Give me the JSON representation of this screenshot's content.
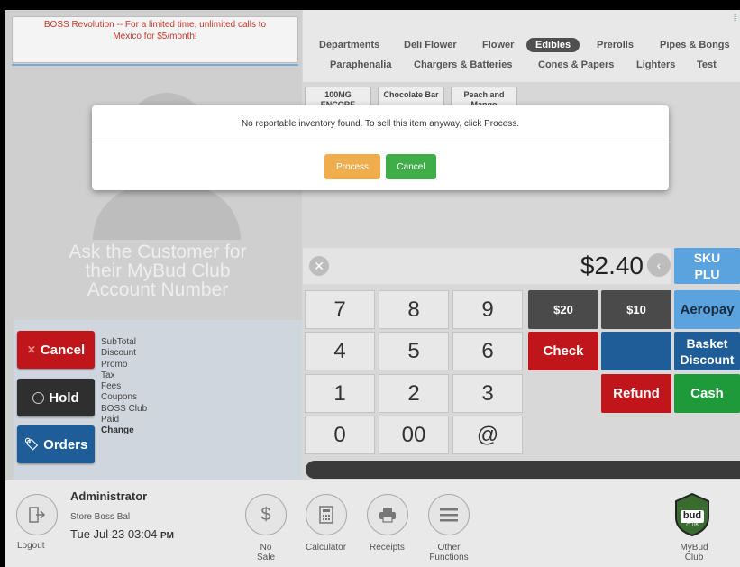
{
  "promo": {
    "line1": "BOSS Revolution -- For a limited time, unlimited calls to",
    "line2": "Mexico for $5/month!"
  },
  "customer": {
    "line1": "Ask the Customer for",
    "line2": "their MyBud Club",
    "line3": "Account Number"
  },
  "left_buttons": {
    "cancel": "Cancel",
    "hold": "Hold",
    "orders": "Orders"
  },
  "totals": [
    "SubTotal",
    "Discount",
    "Promo",
    "Tax",
    "Fees",
    "Coupons",
    "BOSS Club",
    "Paid",
    "Change"
  ],
  "categories_row1": [
    "Departments",
    "Deli Flower",
    "Flower",
    "Edibles",
    "Prerolls",
    "Pipes & Bongs"
  ],
  "categories_row2": [
    "Paraphenalia",
    "Chargers & Batteries",
    "Cones & Papers",
    "Lighters",
    "Test"
  ],
  "active_category": "Edibles",
  "products": [
    {
      "line1": "100MG",
      "line2": "ENCORE"
    },
    {
      "line1": "Chocolate Bar",
      "line2": ""
    },
    {
      "line1": "Peach and",
      "line2": "Mango"
    }
  ],
  "amount": "$2.40",
  "keypad": [
    "7",
    "8",
    "9",
    "4",
    "5",
    "6",
    "1",
    "2",
    "3",
    "0",
    "00",
    "@"
  ],
  "function_keys": {
    "sku_line1": "SKU",
    "sku_line2": "PLU",
    "k20": "$20",
    "k10": "$10",
    "aeropay": "Aeropay",
    "check": "Check",
    "basket_line1": "Basket",
    "basket_line2": "Discount",
    "refund": "Refund",
    "cash": "Cash"
  },
  "colors": {
    "red": "#c0161b",
    "dark": "#333333",
    "blue": "#1f5d99",
    "sku_blue": "#5aa3df",
    "green": "#1e9a3a",
    "orange": "#f0ad4e",
    "modal_green": "#3fae49"
  },
  "footer": {
    "user": "Administrator",
    "store": "Store Boss Bal",
    "datetime": "Tue Jul 23 03:04",
    "ampm": "PM",
    "logout": "Logout",
    "no_sale_line1": "No",
    "no_sale_line2": "Sale",
    "calculator": "Calculator",
    "receipts": "Receipts",
    "other_line1": "Other",
    "other_line2": "Functions",
    "mybud_line1": "MyBud",
    "mybud_line2": "Club",
    "logo_text": "bud",
    "logo_sub": "CLUB"
  },
  "modal": {
    "message": "No reportable inventory found. To sell this item anyway, click Process.",
    "process": "Process",
    "cancel": "Cancel"
  }
}
